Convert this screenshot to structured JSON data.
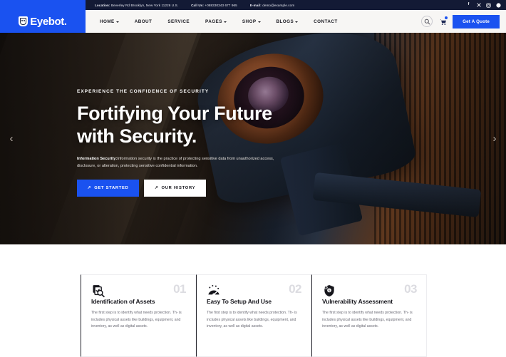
{
  "topbar": {
    "location_label": "Location:",
    "location_value": "Beverley Rd Brooklyn, New York 11226 U.S.",
    "phone_label": "Call Us:",
    "phone_value": "+088330343 677 965",
    "email_label": "E-mail:",
    "email_value": "demo@example.com",
    "socials": [
      {
        "name": "facebook-icon",
        "glyph": "f"
      },
      {
        "name": "x-twitter-icon",
        "glyph": "X"
      },
      {
        "name": "instagram-icon",
        "glyph": "◎"
      },
      {
        "name": "pinterest-icon",
        "glyph": "P"
      }
    ]
  },
  "header": {
    "logo_text": "Eyebot.",
    "nav": [
      {
        "label": "HOME",
        "caret": true
      },
      {
        "label": "ABOUT",
        "caret": false
      },
      {
        "label": "SERVICE",
        "caret": false
      },
      {
        "label": "PAGES",
        "caret": true
      },
      {
        "label": "SHOP",
        "caret": true
      },
      {
        "label": "BLOGS",
        "caret": true
      },
      {
        "label": "CONTACT",
        "caret": false
      }
    ],
    "search_icon": "search-icon",
    "cart_icon": "cart-icon",
    "quote_label": "Get A Quote"
  },
  "hero": {
    "eyebrow": "EXPERIENCE THE CONFIDENCE OF SECURITY",
    "title_line1": "Fortifying Your Future",
    "title_line2": "with Security.",
    "desc_strong": "Information Security:",
    "desc_text": "Information security is the practice of protecting sensitive data from unauthorized access, disclosure, or alteration, protecting sensitive confidential information.",
    "btn_primary": "GET STARTED",
    "btn_secondary": "OUR HISTORY",
    "arrow_glyph": "↗",
    "prev_glyph": "‹",
    "next_glyph": "›"
  },
  "cards": [
    {
      "number": "01",
      "icon": "asset-search-icon",
      "title": "Identification of Assets",
      "text": "The first step is to identify what needs protection. Th- is includes physical assets like buildings, equipment, and inventory, as well as digital assets."
    },
    {
      "number": "02",
      "icon": "gauge-icon",
      "title": "Easy To Setup And Use",
      "text": "The first step is to identify what needs protection. Th- is includes physical assets like buildings, equipment, and inventory, as well as digital assets."
    },
    {
      "number": "03",
      "icon": "shield-lock-icon",
      "title": "Vulnerability Assessment",
      "text": "The first step is to identify what needs protection. Th- is includes physical assets like buildings, equipment, and inventory, as well as digital assets."
    }
  ],
  "colors": {
    "brand_blue": "#1a52f0",
    "topbar_dark": "#131a35",
    "header_bg": "#f7f6f4",
    "text_dark": "#16161c",
    "muted": "#6b6b75",
    "card_num": "#dcdce1"
  }
}
